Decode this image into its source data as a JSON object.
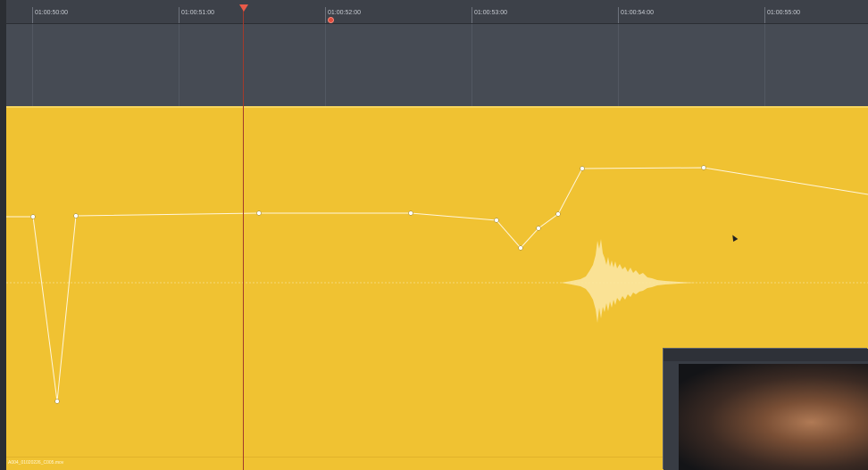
{
  "ruler": {
    "labels": [
      "01:00:50:00",
      "01:00:51:00",
      "01:00:52:00",
      "01:00:53:00",
      "01:00:54:00",
      "01:00:55:00"
    ]
  },
  "clip": {
    "name": "A004_01020226_C005.mov"
  },
  "colors": {
    "clip": "#f0c232",
    "ruler": "#3d4149",
    "empty_track": "#464b54",
    "playhead": "#ea5a48",
    "marker": "#e24a3c"
  }
}
